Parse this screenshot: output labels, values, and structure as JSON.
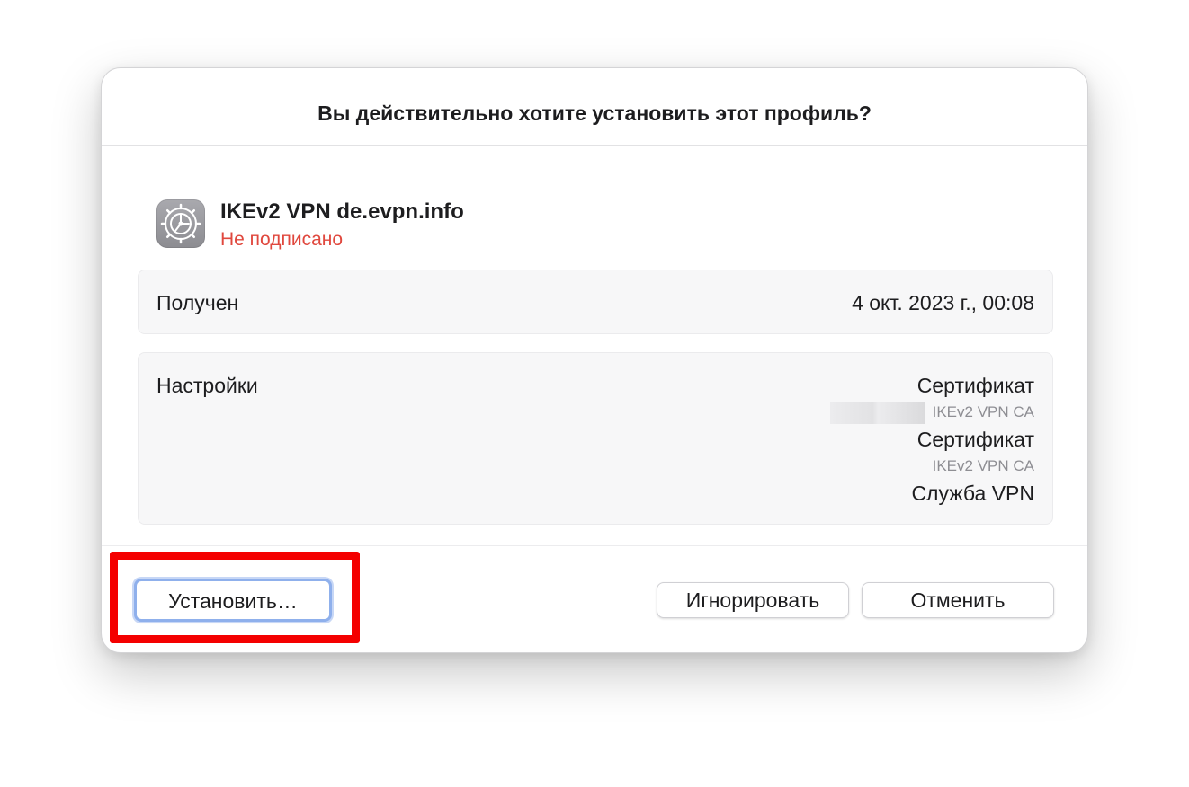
{
  "dialog": {
    "title": "Вы действительно хотите установить этот профиль?"
  },
  "profile": {
    "icon": "settings-gear-icon",
    "name": "IKEv2 VPN de.evpn.info",
    "status": "Не подписано",
    "status_color": "#e0483e"
  },
  "received": {
    "label": "Получен",
    "value": "4 окт. 2023 г., 00:08"
  },
  "settings": {
    "label": "Настройки",
    "items": [
      {
        "title": "Сертификат",
        "subtitle": "IKEv2 VPN CA",
        "redacted": true
      },
      {
        "title": "Сертификат",
        "subtitle": "IKEv2 VPN CA",
        "redacted": false
      },
      {
        "title": "Служба VPN"
      }
    ]
  },
  "buttons": {
    "install": "Установить…",
    "ignore": "Игнорировать",
    "cancel": "Отменить"
  },
  "colors": {
    "highlight": "#f40000",
    "focus_ring": "#8fb0ec"
  }
}
